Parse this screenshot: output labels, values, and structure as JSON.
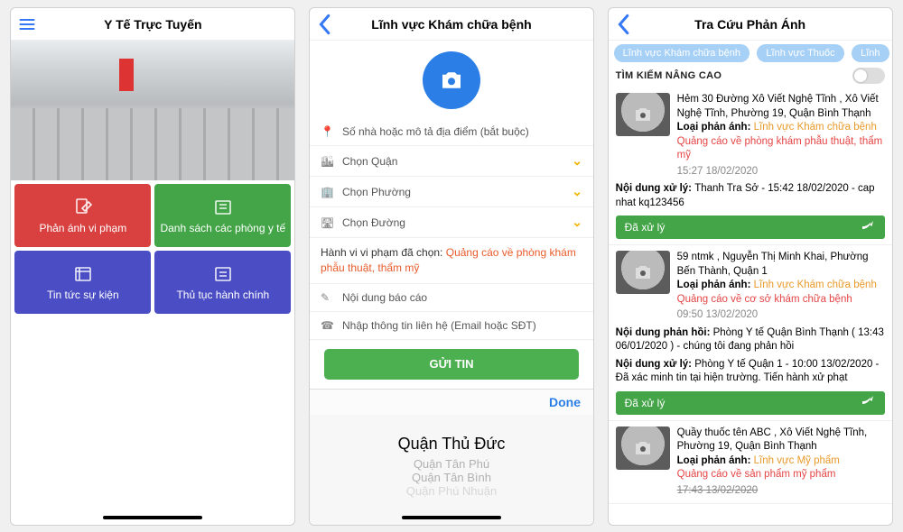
{
  "screen1": {
    "title": "Y Tế Trực Tuyến",
    "tiles": {
      "t1": "Phản ánh vi phạm",
      "t2": "Danh sách các phòng y tế",
      "t3": "Tin tức sự kiện",
      "t4": "Thủ tục hành chính"
    }
  },
  "screen2": {
    "title": "Lĩnh vực Khám chữa bệnh",
    "fields": {
      "address": "Số nhà hoặc mô tả địa điểm (bắt buộc)",
      "district": "Chọn Quận",
      "ward": "Chọn Phường",
      "street": "Chọn Đường"
    },
    "violation": {
      "lead": "Hành vi vi phạm đã chọn: ",
      "value": "Quảng cáo về phòng khám phẫu thuật, thẩm mỹ"
    },
    "report_ph": "Nội dung báo cáo",
    "contact_ph": "Nhập thông tin liên hệ (Email hoặc SĐT)",
    "submit": "GỬI TIN",
    "done": "Done",
    "picker": {
      "sel": "Quận Thủ Đức",
      "a": "Quận Tân Phú",
      "b": "Quận Tân Bình",
      "c": "Quận Phú Nhuận"
    }
  },
  "screen3": {
    "title": "Tra Cứu Phản Ánh",
    "chips": {
      "c1": "Lĩnh vực Khám chữa bệnh",
      "c2": "Lĩnh vực Thuốc",
      "c3": "Lĩnh"
    },
    "adv": "TÌM KIẾM NÂNG CAO",
    "status": "Đã xử lý",
    "type_label": "Loại phản ánh: ",
    "items": [
      {
        "addr": "Hẻm 30 Đường Xô Viết Nghệ Tĩnh , Xô Viết Nghệ Tĩnh, Phường 19, Quận Bình Thạnh",
        "type": "Lĩnh vực Khám chữa bệnh",
        "viol": "Quảng cáo về phòng khám phẫu thuật, thẩm mỹ",
        "time": "15:27 18/02/2020",
        "meta_label": "Nội dung xử lý: ",
        "meta_value": "Thanh Tra Sở - 15:42 18/02/2020 - cap nhat kq123456"
      },
      {
        "addr": "59 ntmk , Nguyễn Thị Minh Khai, Phường Bến Thành, Quận 1",
        "type": "Lĩnh vực Khám chữa bệnh",
        "viol": "Quảng cáo về cơ sở khám chữa bệnh",
        "time": "09:50 13/02/2020",
        "meta1_label": "Nội dung phản hồi: ",
        "meta1_value": "Phòng Y tế Quận Bình Thạnh ( 13:43 06/01/2020 ) - chúng tôi đang phản hồi",
        "meta2_label": "Nội dung xử lý: ",
        "meta2_value": "Phòng Y tế Quận 1 - 10:00 13/02/2020 - Đã xác minh tin tại hiện trường. Tiến hành xử phạt"
      },
      {
        "addr": "Quầy thuốc tên ABC , Xô Viết Nghệ Tĩnh, Phường 19, Quận Bình Thạnh",
        "type": "Lĩnh vực Mỹ phẩm",
        "viol": "Quảng cáo về sản phẩm mỹ phẩm",
        "time": "17:43 13/02/2020"
      }
    ]
  }
}
